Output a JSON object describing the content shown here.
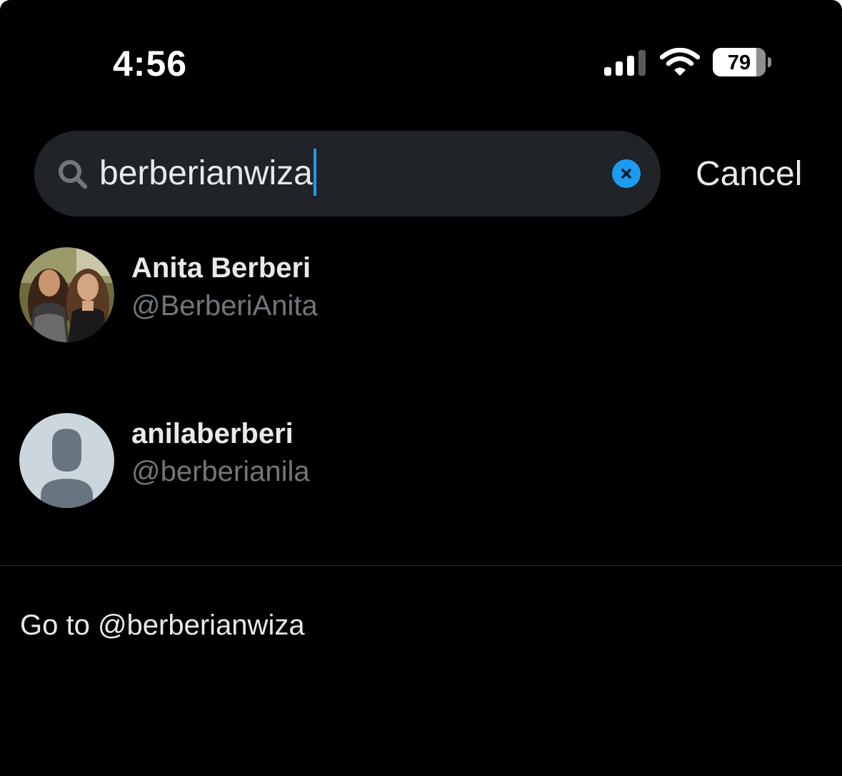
{
  "status_bar": {
    "time": "4:56",
    "battery_level": "79"
  },
  "search": {
    "query": "berberianwiza",
    "cancel_label": "Cancel"
  },
  "results": [
    {
      "display_name": "Anita Berberi",
      "handle": "@BerberiAnita",
      "avatar": "photo"
    },
    {
      "display_name": "anilaberberi",
      "handle": "@berberianila",
      "avatar": "default-profile"
    }
  ],
  "goto": {
    "label": "Go to @berberianwiza"
  },
  "colors": {
    "background": "#000000",
    "search_field": "#202327",
    "accent": "#1d9bf0",
    "primary_text": "#e7e9ea",
    "secondary_text": "#71767b",
    "divider": "#2f3336"
  }
}
